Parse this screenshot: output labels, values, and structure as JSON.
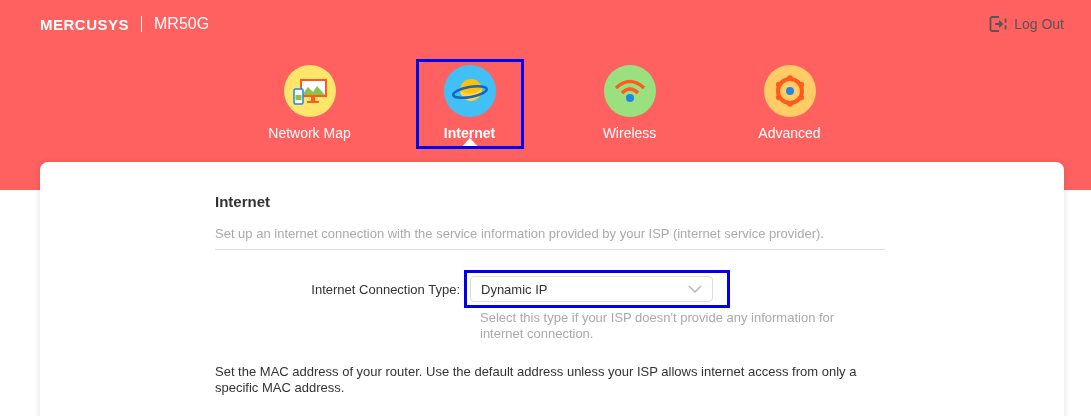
{
  "header": {
    "brand": "MERCUSYS",
    "model": "MR50G",
    "logout": "Log Out"
  },
  "nav": [
    {
      "label": "Network Map",
      "kind": "map",
      "selected": false,
      "highlighted": false
    },
    {
      "label": "Internet",
      "kind": "internet",
      "selected": true,
      "highlighted": true
    },
    {
      "label": "Wireless",
      "kind": "wireless",
      "selected": false,
      "highlighted": false
    },
    {
      "label": "Advanced",
      "kind": "advanced",
      "selected": false,
      "highlighted": false
    }
  ],
  "section": {
    "title": "Internet",
    "description": "Set up an internet connection with the service information provided by your ISP (internet service provider).",
    "connection_type": {
      "label": "Internet Connection Type:",
      "value": "Dynamic IP",
      "highlighted": true,
      "hint": "Select this type if your ISP doesn't provide any information for internet connection."
    },
    "mac_note": "Set the MAC address of your router. Use the default address unless your ISP allows internet access from only a specific MAC address."
  }
}
